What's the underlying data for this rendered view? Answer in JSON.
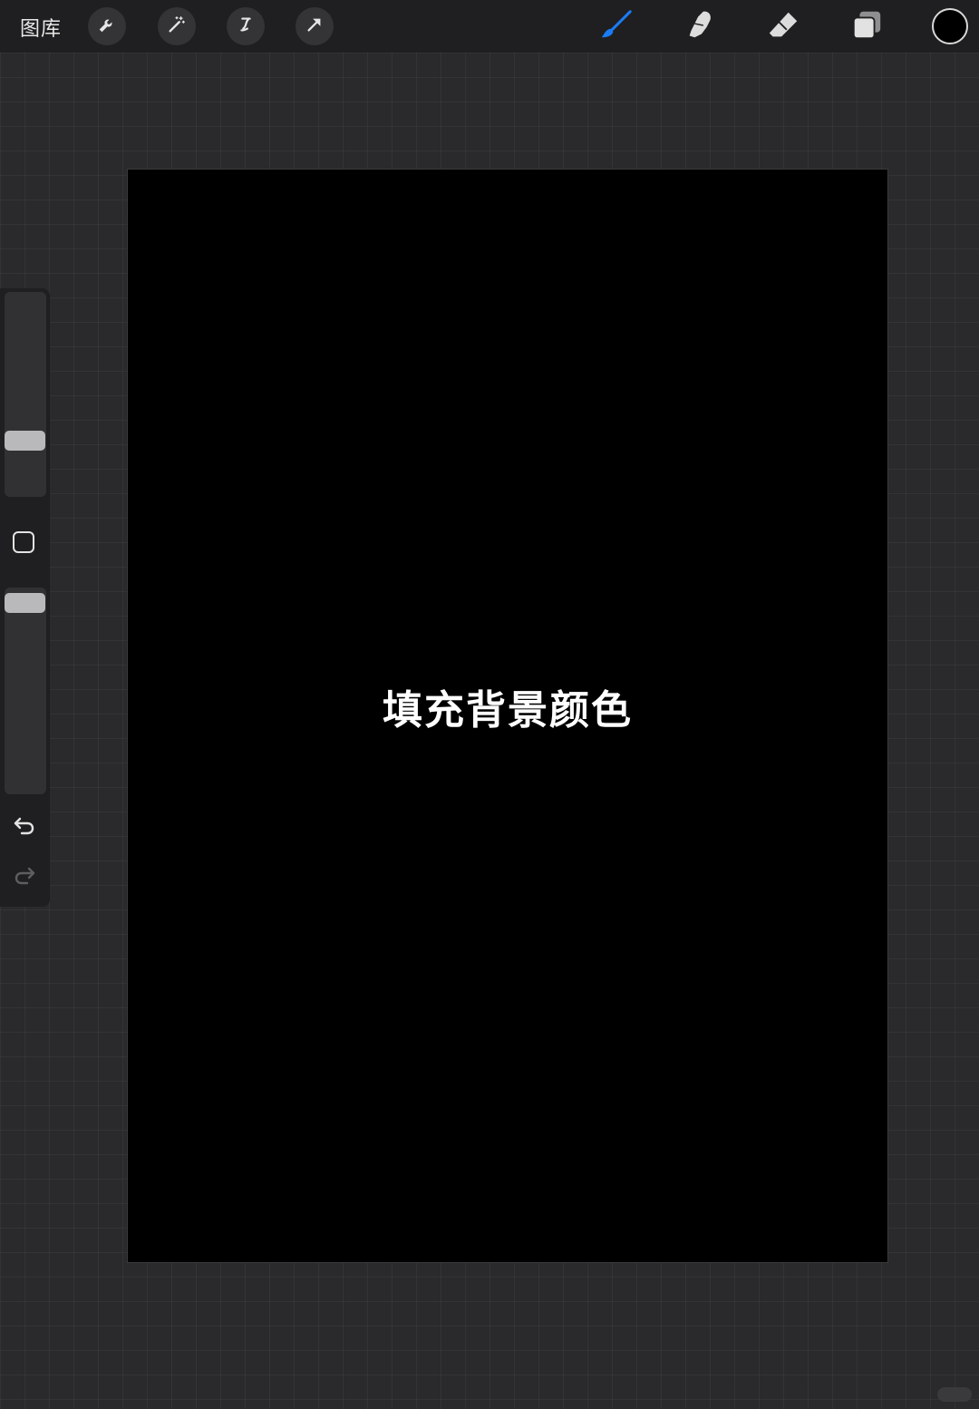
{
  "toolbar": {
    "gallery_label": "图库",
    "left_tools": [
      {
        "name": "actions",
        "icon": "wrench-icon"
      },
      {
        "name": "adjustments",
        "icon": "magic-wand-icon"
      },
      {
        "name": "selection",
        "icon": "selection-s-icon"
      },
      {
        "name": "transform",
        "icon": "arrow-cursor-icon"
      }
    ],
    "right_tools": [
      {
        "name": "paint",
        "icon": "brush-icon",
        "active": true,
        "color": "#1a7cf5"
      },
      {
        "name": "smudge",
        "icon": "smudge-finger-icon"
      },
      {
        "name": "erase",
        "icon": "eraser-icon"
      },
      {
        "name": "layers",
        "icon": "layers-icon"
      }
    ],
    "current_color": "#000000"
  },
  "canvas": {
    "background_color": "#000000",
    "caption": "填充背景颜色"
  },
  "sidebar": {
    "brush_size_level": 0.3,
    "opacity_level": 1.0,
    "undo_icon": "undo-icon",
    "redo_icon": "redo-icon"
  },
  "colors": {
    "app_bg": "#2a2a2c",
    "toolbar_bg": "#1f1f21",
    "accent": "#1a7cf5"
  }
}
